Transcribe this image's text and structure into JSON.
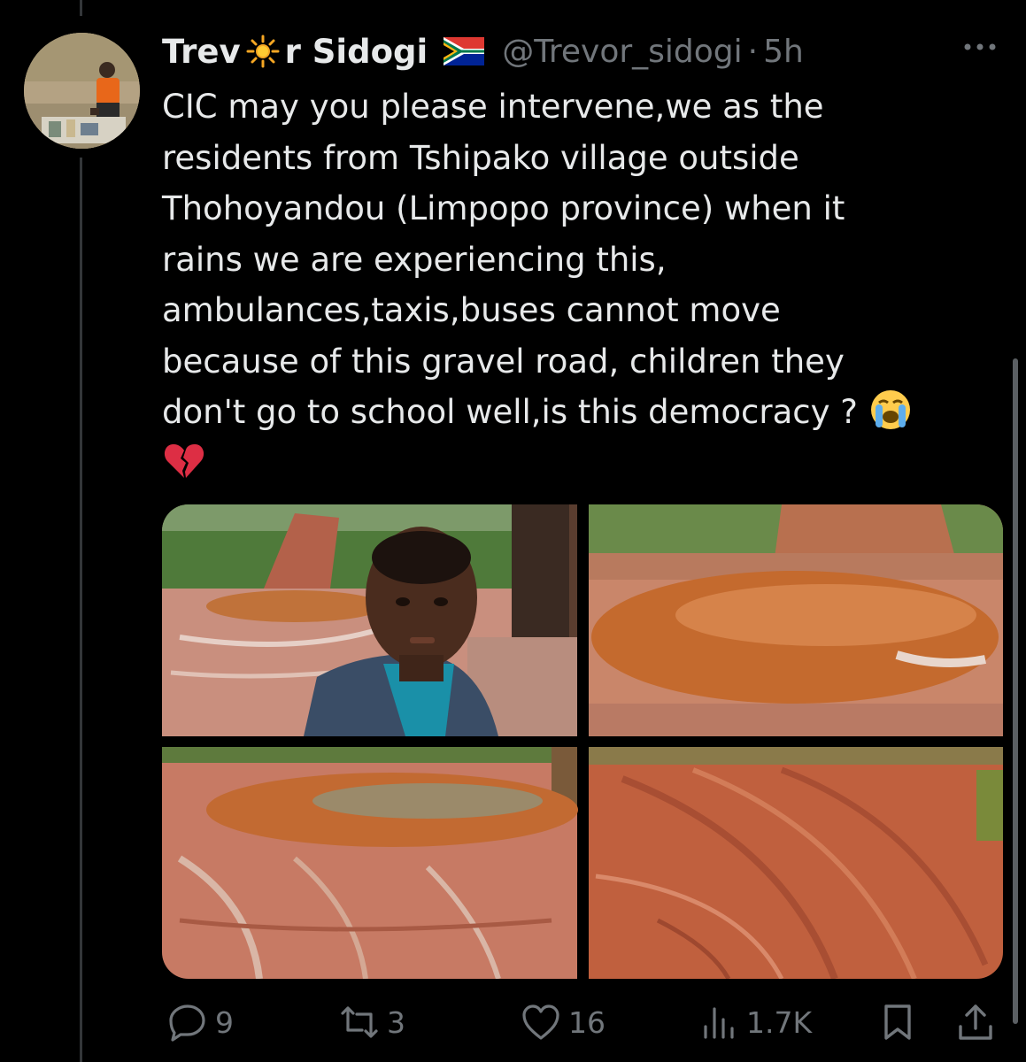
{
  "author": {
    "name_start": "Trev",
    "name_end": "r Sidogi",
    "name_emoji_icon": "sun-icon",
    "flag_icon": "south-africa-flag-icon",
    "handle": "@Trevor_sidogi",
    "separator": "·",
    "time": "5h"
  },
  "tweet": {
    "text": "CIC may you please intervene,we as the\nresidents from Tshipako village outside\nThohoyandou (Limpopo province) when it\nrains we are experiencing this,\nambulances,taxis,buses cannot move\nbecause of this gravel road, children they\ndon't go to school well,is this democracy ? ",
    "emoji_1": "loudly-crying-face-icon",
    "emoji_2": "broken-heart-icon"
  },
  "media": {
    "photos": [
      "selfie-on-muddy-road",
      "flooded-muddy-road",
      "puddled-gravel-road",
      "rutted-red-mud-road"
    ]
  },
  "actions": {
    "replies": "9",
    "reposts": "3",
    "likes": "16",
    "views": "1.7K"
  },
  "colors": {
    "background": "#000000",
    "text": "#e7e9ea",
    "secondary": "#71767b"
  }
}
